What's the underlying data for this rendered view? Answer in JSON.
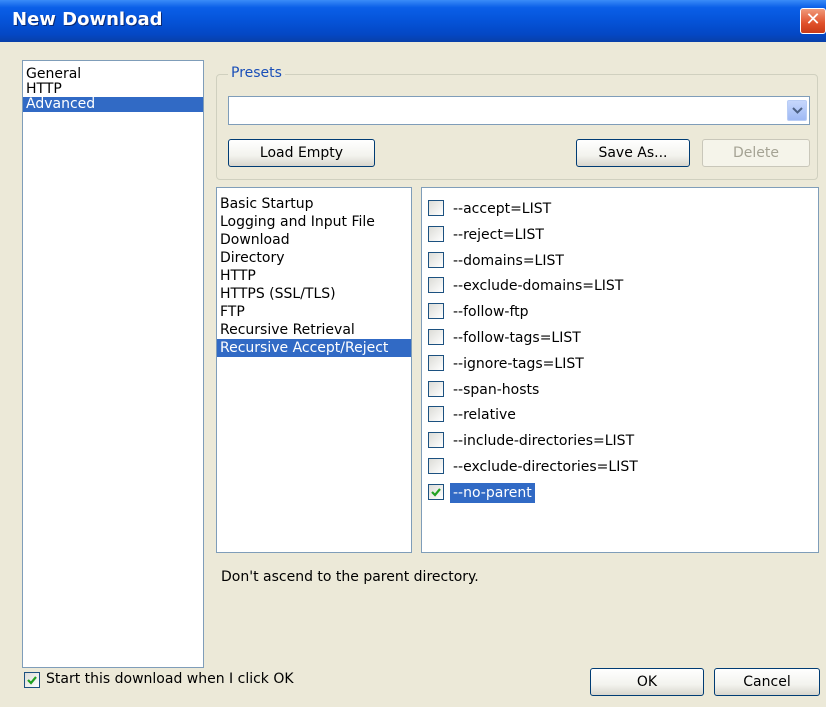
{
  "window": {
    "title": "New Download"
  },
  "categories": [
    "General",
    "HTTP",
    "Advanced"
  ],
  "categories_selected": "Advanced",
  "presets": {
    "group_label": "Presets",
    "value": "",
    "load_empty": "Load Empty",
    "save_as": "Save As...",
    "delete": "Delete"
  },
  "sections": [
    "Basic Startup",
    "Logging and Input File",
    "Download",
    "Directory",
    "HTTP",
    "HTTPS (SSL/TLS)",
    "FTP",
    "Recursive Retrieval",
    "Recursive Accept/Reject"
  ],
  "sections_selected": "Recursive Accept/Reject",
  "options": [
    {
      "label": "--accept=LIST",
      "checked": false
    },
    {
      "label": "--reject=LIST",
      "checked": false
    },
    {
      "label": "--domains=LIST",
      "checked": false
    },
    {
      "label": "--exclude-domains=LIST",
      "checked": false
    },
    {
      "label": "--follow-ftp",
      "checked": false
    },
    {
      "label": "--follow-tags=LIST",
      "checked": false
    },
    {
      "label": "--ignore-tags=LIST",
      "checked": false
    },
    {
      "label": "--span-hosts",
      "checked": false
    },
    {
      "label": "--relative",
      "checked": false
    },
    {
      "label": "--include-directories=LIST",
      "checked": false
    },
    {
      "label": "--exclude-directories=LIST",
      "checked": false
    },
    {
      "label": "--no-parent",
      "checked": true
    }
  ],
  "options_selected": "--no-parent",
  "description": "Don't ascend to the parent directory.",
  "start_download": {
    "label": "Start this download when I click OK",
    "checked": true
  },
  "footer": {
    "ok": "OK",
    "cancel": "Cancel"
  },
  "colors": {
    "title_bar": "#0553d8",
    "selection": "#316ac5",
    "dialog_bg": "#ece9d8",
    "close": "#e0502a"
  },
  "icons": {
    "close": "close-icon",
    "dropdown": "chevron-down-icon",
    "check": "checkmark-icon"
  }
}
